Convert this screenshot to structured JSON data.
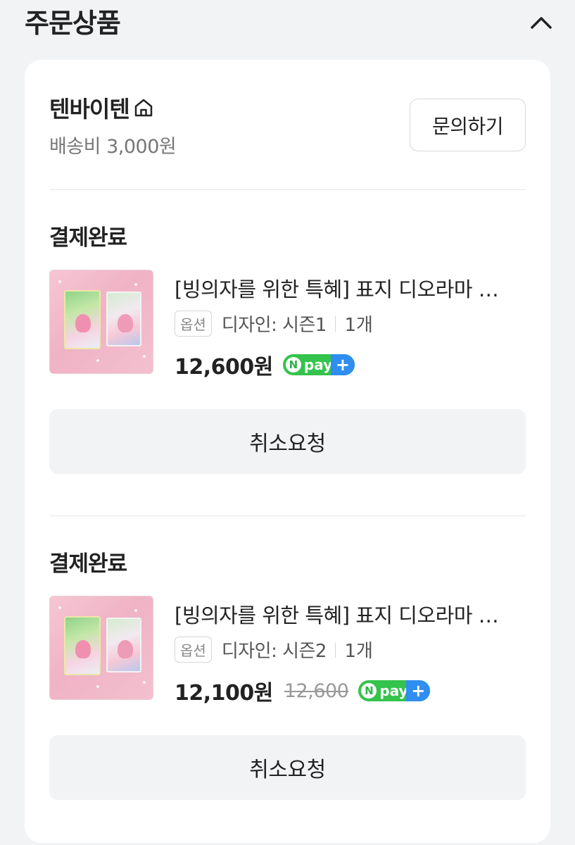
{
  "section": {
    "title": "주문상품",
    "collapse_icon": "chevron-up-icon"
  },
  "seller": {
    "name": "텐바이텐",
    "home_icon": "home-icon",
    "shipping_fee": "배송비 3,000원",
    "inquiry_label": "문의하기"
  },
  "items": [
    {
      "status": "결제완료",
      "name": "[빙의자를 위한 특혜] 표지 디오라마 아크릴 스탠드",
      "option_badge": "옵션",
      "option": "디자인: 시즌1",
      "quantity": "1개",
      "price": "12,600원",
      "original_price": "",
      "payment_badge": "npay-plus",
      "cancel_label": "취소요청"
    },
    {
      "status": "결제완료",
      "name": "[빙의자를 위한 특혜] 표지 디오라마 아크릴 스탠드",
      "option_badge": "옵션",
      "option": "디자인: 시즌2",
      "quantity": "1개",
      "price": "12,100원",
      "original_price": "12,600",
      "payment_badge": "npay-plus",
      "cancel_label": "취소요청"
    }
  ],
  "colors": {
    "npay_green": "#34c34c",
    "npay_blue": "#2f8ef0",
    "button_bg": "#f2f3f5"
  }
}
